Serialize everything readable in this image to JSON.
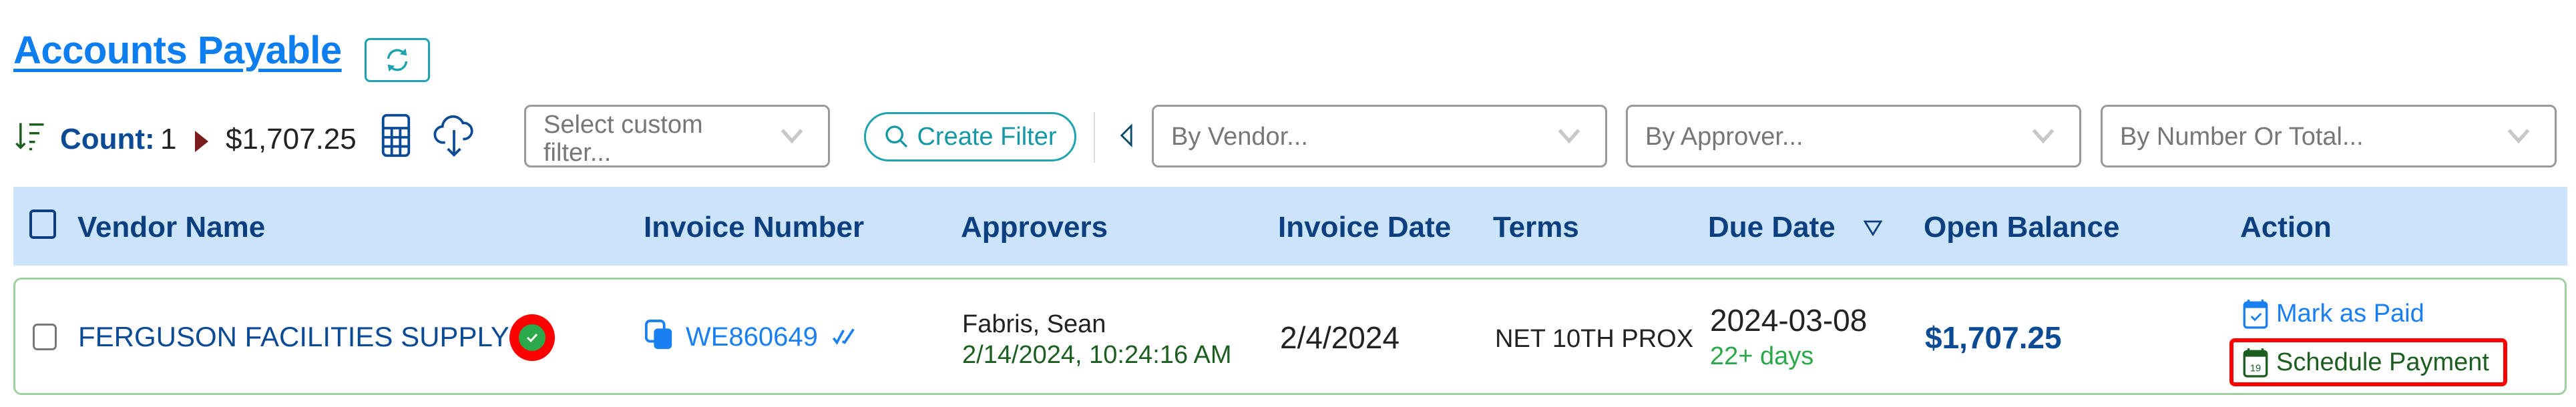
{
  "header": {
    "title": "Accounts Payable",
    "refresh_icon": "refresh-icon"
  },
  "toolbar": {
    "count_label": "Count:",
    "count_value": "1",
    "total_value": "$1,707.25",
    "custom_filter_placeholder": "Select custom filter...",
    "create_filter_label": "Create Filter",
    "vendor_filter_placeholder": "By Vendor...",
    "approver_filter_placeholder": "By Approver...",
    "number_filter_placeholder": "By Number Or Total..."
  },
  "table": {
    "columns": [
      {
        "key": "vendor",
        "label": "Vendor Name"
      },
      {
        "key": "invoice_number",
        "label": "Invoice Number"
      },
      {
        "key": "approvers",
        "label": "Approvers"
      },
      {
        "key": "invoice_date",
        "label": "Invoice Date"
      },
      {
        "key": "terms",
        "label": "Terms"
      },
      {
        "key": "due_date",
        "label": "Due Date",
        "sorted": "descending"
      },
      {
        "key": "open_balance",
        "label": "Open Balance"
      },
      {
        "key": "action",
        "label": "Action"
      }
    ],
    "rows": [
      {
        "vendor": "FERGUSON FACILITIES SUPPLY",
        "vendor_verified": true,
        "invoice_number": "WE860649",
        "approver_name": "Fabris, Sean",
        "approver_timestamp": "2/14/2024, 10:24:16 AM",
        "invoice_date": "2/4/2024",
        "terms": "NET 10TH PROX",
        "due_date": "2024-03-08",
        "due_in": "22+ days",
        "open_balance": "$1,707.25",
        "actions": {
          "mark_paid": "Mark as Paid",
          "schedule_payment": "Schedule Payment",
          "calendar_day": "19"
        }
      }
    ]
  },
  "colors": {
    "title": "#0d7ef0",
    "accent_teal": "#1fa3b0",
    "header_band": "#cce4fb",
    "header_text": "#0b3f7f",
    "row_border": "#9fd09f",
    "green_dark": "#1b5e20",
    "green": "#2ba84a",
    "highlight_red": "#ff0000"
  }
}
